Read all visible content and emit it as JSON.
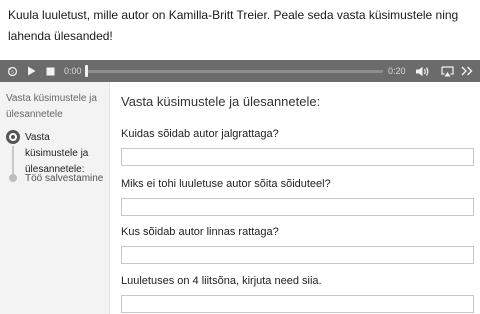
{
  "instruction": "Kuula luuletust, mille autor on Kamilla-Britt Treier. Peale seda vasta küsimustele ning lahenda ülesanded!",
  "player": {
    "current_time": "0:00",
    "duration": "0:20",
    "progress": 0,
    "icons": [
      "replay-icon",
      "play-icon",
      "stop-icon",
      "volume-icon",
      "airplay-icon",
      "forward-icon"
    ]
  },
  "sidebar": {
    "heading": "Vasta küsimustele ja ülesannetele",
    "steps": [
      {
        "label": "Vasta küsimustele ja ülesannetele:",
        "active": true
      },
      {
        "label": "Töö salvestamine",
        "active": false
      }
    ]
  },
  "main": {
    "title": "Vasta küsimustele ja ülesannetele:",
    "questions": [
      {
        "label": "Kuidas sõidab autor jalgrattaga?",
        "value": ""
      },
      {
        "label": "Miks ei tohi luuletuse autor sõita sõiduteel?",
        "value": ""
      },
      {
        "label": "Kus sõidab autor linnas rattaga?",
        "value": ""
      },
      {
        "label": "Luuletuses on 4 liitsõna, kirjuta need siia.",
        "value": ""
      }
    ]
  }
}
